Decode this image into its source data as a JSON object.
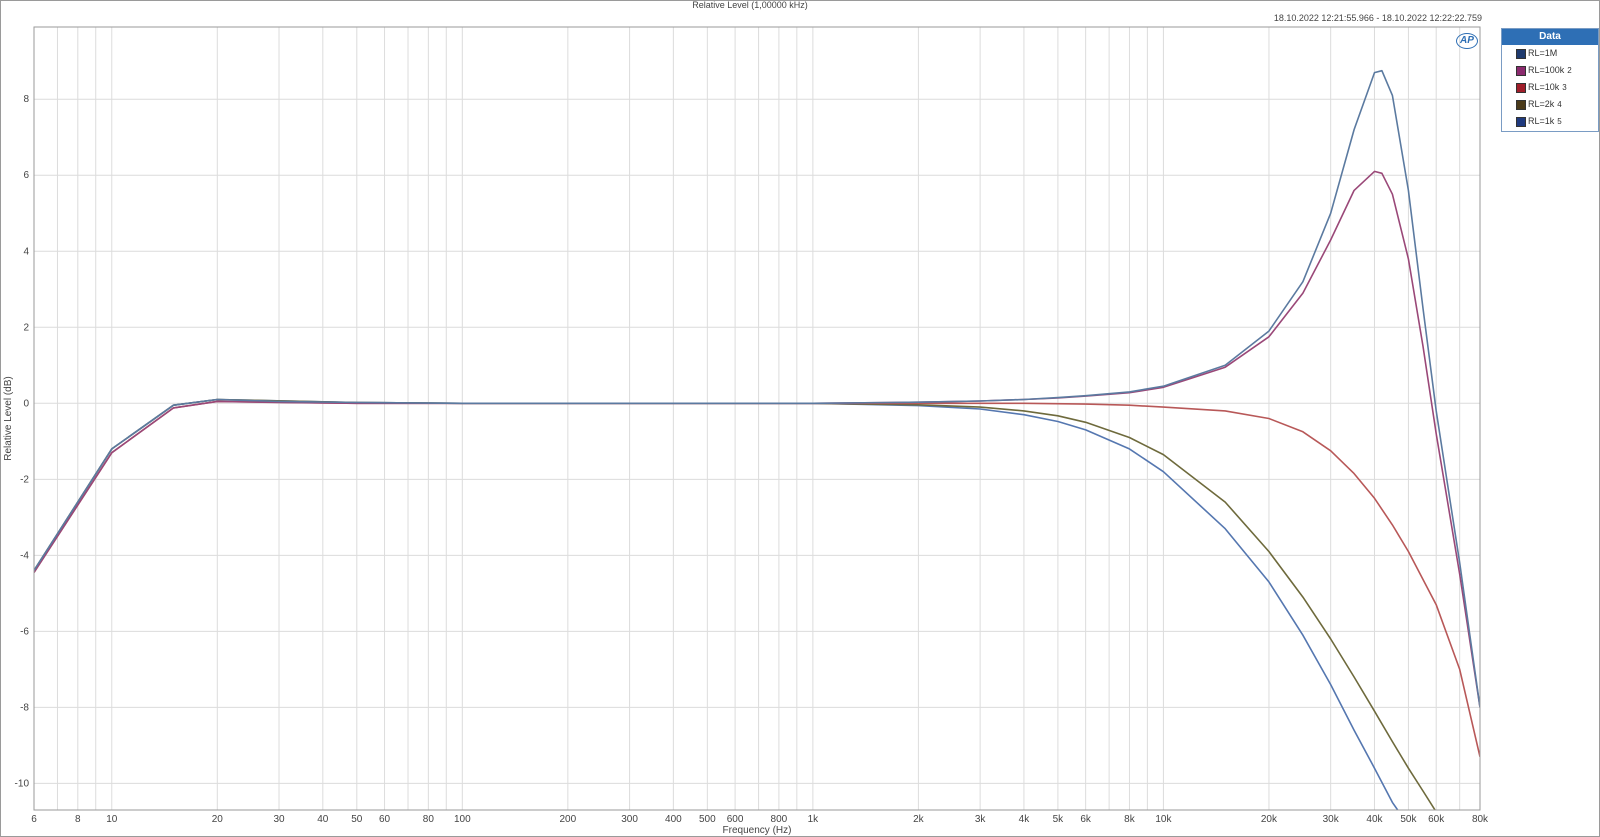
{
  "chart_data": {
    "type": "line",
    "title": "Relative Level (1,00000 kHz)",
    "timestamp": "18.10.2022 12:21:55.966 - 18.10.2022 12:22:22.759",
    "xlabel": "Frequency (Hz)",
    "ylabel": "Relative Level (dB)",
    "x_scale": "log",
    "xlim": [
      6,
      80000
    ],
    "ylim": [
      -10.7,
      9.9
    ],
    "grid": true,
    "x_ticks": [
      6,
      8,
      10,
      20,
      30,
      40,
      50,
      60,
      80,
      100,
      200,
      300,
      400,
      500,
      600,
      800,
      1000,
      2000,
      3000,
      4000,
      5000,
      6000,
      8000,
      10000,
      20000,
      30000,
      40000,
      50000,
      60000,
      80000
    ],
    "x_tick_labels": [
      "6",
      "8",
      "10",
      "20",
      "30",
      "40",
      "50",
      "60",
      "80",
      "100",
      "200",
      "300",
      "400",
      "500",
      "600",
      "800",
      "1k",
      "2k",
      "3k",
      "4k",
      "5k",
      "6k",
      "8k",
      "10k",
      "20k",
      "30k",
      "40k",
      "50k",
      "60k",
      "80k"
    ],
    "y_ticks": [
      8,
      6,
      4,
      2,
      0,
      -2,
      -4,
      -6,
      -8,
      -10
    ],
    "y_tick_labels": [
      "8",
      "6",
      "4",
      "2",
      "0",
      "-2",
      "-4",
      "-6",
      "-8",
      "-10"
    ],
    "legend_title": "Data",
    "legend_position": "top-right",
    "series": [
      {
        "name": "RL=1M",
        "index": "",
        "color": "#5b7aa0",
        "swatch": "#1f3a6e",
        "x": [
          6,
          10,
          15,
          20,
          30,
          50,
          100,
          200,
          500,
          1000,
          2000,
          3000,
          4000,
          5000,
          6000,
          8000,
          10000,
          15000,
          20000,
          25000,
          30000,
          35000,
          40000,
          42000,
          45000,
          50000,
          55000,
          60000,
          70000,
          80000
        ],
        "y": [
          -4.4,
          -1.2,
          -0.05,
          0.1,
          0.05,
          0.02,
          0.0,
          0.0,
          0.0,
          0.0,
          0.03,
          0.06,
          0.1,
          0.15,
          0.2,
          0.3,
          0.45,
          1.0,
          1.9,
          3.2,
          5.0,
          7.2,
          8.7,
          8.75,
          8.1,
          5.6,
          2.5,
          -0.2,
          -4.2,
          -8.0
        ]
      },
      {
        "name": "RL=100k",
        "index": "2",
        "color": "#9a4878",
        "swatch": "#8b2a6e",
        "x": [
          6,
          10,
          15,
          20,
          30,
          50,
          100,
          200,
          500,
          1000,
          2000,
          3000,
          4000,
          5000,
          6000,
          8000,
          10000,
          15000,
          20000,
          25000,
          30000,
          35000,
          40000,
          42000,
          45000,
          50000,
          55000,
          60000,
          70000,
          80000
        ],
        "y": [
          -4.45,
          -1.3,
          -0.12,
          0.05,
          0.02,
          0.0,
          0.0,
          0.0,
          0.0,
          0.0,
          0.03,
          0.06,
          0.1,
          0.14,
          0.19,
          0.28,
          0.42,
          0.95,
          1.75,
          2.9,
          4.3,
          5.6,
          6.1,
          6.05,
          5.5,
          3.8,
          1.5,
          -0.8,
          -4.5,
          -8.0
        ]
      },
      {
        "name": "RL=10k",
        "index": "3",
        "color": "#b85858",
        "swatch": "#a01e2a",
        "x": [
          6,
          10,
          15,
          20,
          50,
          100,
          500,
          1000,
          2000,
          4000,
          6000,
          8000,
          10000,
          15000,
          20000,
          25000,
          30000,
          35000,
          40000,
          45000,
          50000,
          60000,
          70000,
          80000
        ],
        "y": [
          -4.45,
          -1.3,
          -0.12,
          0.05,
          0.0,
          0.0,
          0.0,
          0.0,
          0.0,
          0.0,
          -0.02,
          -0.05,
          -0.1,
          -0.2,
          -0.4,
          -0.75,
          -1.25,
          -1.85,
          -2.5,
          -3.2,
          -3.9,
          -5.3,
          -7.0,
          -9.3
        ]
      },
      {
        "name": "RL=2k",
        "index": "4",
        "color": "#6e6a3c",
        "swatch": "#4a3a1a",
        "x": [
          6,
          10,
          15,
          20,
          50,
          100,
          500,
          1000,
          2000,
          3000,
          4000,
          5000,
          6000,
          8000,
          10000,
          15000,
          20000,
          25000,
          30000,
          35000,
          40000,
          45000,
          50000,
          55000,
          60000
        ],
        "y": [
          -4.4,
          -1.2,
          -0.05,
          0.1,
          0.02,
          0.0,
          0.0,
          0.0,
          -0.04,
          -0.1,
          -0.2,
          -0.33,
          -0.5,
          -0.9,
          -1.35,
          -2.6,
          -3.9,
          -5.1,
          -6.2,
          -7.2,
          -8.1,
          -8.9,
          -9.6,
          -10.2,
          -10.75
        ]
      },
      {
        "name": "RL=1k",
        "index": "5",
        "color": "#5577b0",
        "swatch": "#1f3a7e",
        "x": [
          6,
          10,
          15,
          20,
          50,
          100,
          500,
          1000,
          2000,
          3000,
          4000,
          5000,
          6000,
          8000,
          10000,
          15000,
          20000,
          25000,
          30000,
          35000,
          40000,
          45000,
          47000
        ],
        "y": [
          -4.4,
          -1.2,
          -0.05,
          0.1,
          0.02,
          0.0,
          0.0,
          0.0,
          -0.06,
          -0.15,
          -0.3,
          -0.48,
          -0.7,
          -1.2,
          -1.8,
          -3.3,
          -4.7,
          -6.1,
          -7.4,
          -8.6,
          -9.6,
          -10.5,
          -10.75
        ]
      }
    ]
  }
}
